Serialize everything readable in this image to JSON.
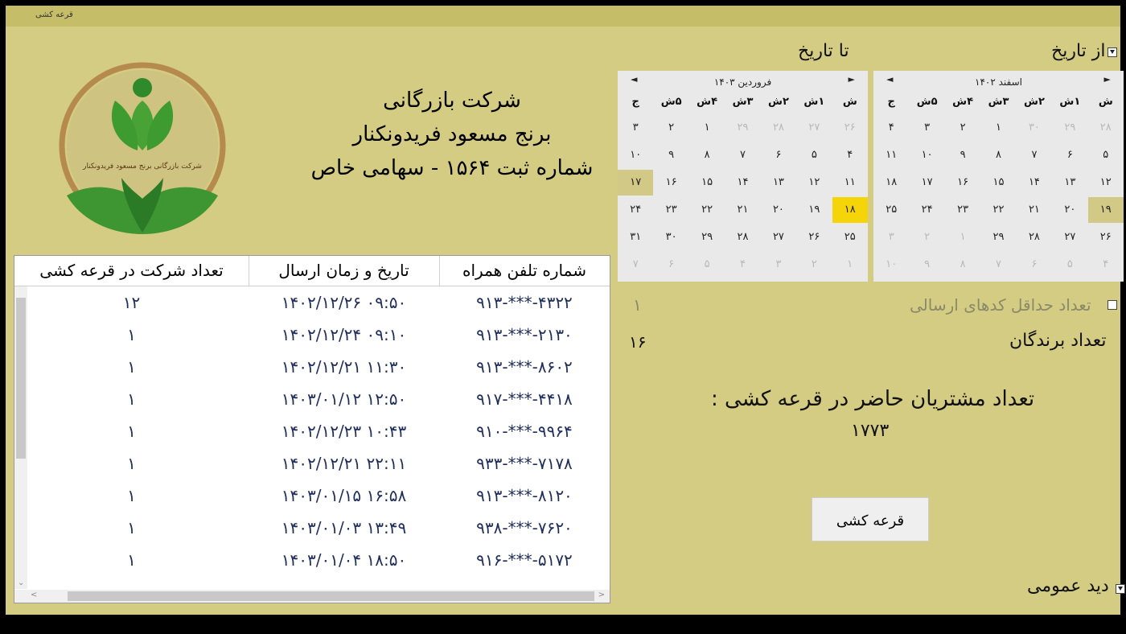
{
  "window": {
    "title": "قرعه کشی"
  },
  "from_date": {
    "label": "از تاریخ",
    "checked": true
  },
  "to_date": {
    "label": "تا تاریخ"
  },
  "calendar_from": {
    "month": "اسفند ۱۴۰۲",
    "prev": "◄",
    "next": "►",
    "weekdays": [
      "ش",
      "۱ش",
      "۲ش",
      "۳ش",
      "۴ش",
      "۵ش",
      "ج"
    ],
    "days": [
      [
        "۲۸",
        "m"
      ],
      [
        "۲۹",
        "m"
      ],
      [
        "۳۰",
        "m"
      ],
      [
        "۱",
        ""
      ],
      [
        "۲",
        ""
      ],
      [
        "۳",
        ""
      ],
      [
        "۴",
        ""
      ],
      [
        "۵",
        ""
      ],
      [
        "۶",
        ""
      ],
      [
        "۷",
        ""
      ],
      [
        "۸",
        ""
      ],
      [
        "۹",
        ""
      ],
      [
        "۱۰",
        ""
      ],
      [
        "۱۱",
        ""
      ],
      [
        "۱۲",
        ""
      ],
      [
        "۱۳",
        ""
      ],
      [
        "۱۴",
        ""
      ],
      [
        "۱۵",
        ""
      ],
      [
        "۱۶",
        ""
      ],
      [
        "۱۷",
        ""
      ],
      [
        "۱۸",
        ""
      ],
      [
        "۱۹",
        "sel"
      ],
      [
        "۲۰",
        ""
      ],
      [
        "۲۱",
        ""
      ],
      [
        "۲۲",
        ""
      ],
      [
        "۲۳",
        ""
      ],
      [
        "۲۴",
        ""
      ],
      [
        "۲۵",
        ""
      ],
      [
        "۲۶",
        ""
      ],
      [
        "۲۷",
        ""
      ],
      [
        "۲۸",
        ""
      ],
      [
        "۲۹",
        ""
      ],
      [
        "۱",
        "m"
      ],
      [
        "۲",
        "m"
      ],
      [
        "۳",
        "m"
      ],
      [
        "۴",
        "m"
      ],
      [
        "۵",
        "m"
      ],
      [
        "۶",
        "m"
      ],
      [
        "۷",
        "m"
      ],
      [
        "۸",
        "m"
      ],
      [
        "۹",
        "m"
      ],
      [
        "۱۰",
        "m"
      ]
    ]
  },
  "calendar_to": {
    "month": "فروردین ۱۴۰۳",
    "prev": "◄",
    "next": "►",
    "weekdays": [
      "ش",
      "۱ش",
      "۲ش",
      "۳ش",
      "۴ش",
      "۵ش",
      "ج"
    ],
    "days": [
      [
        "۲۶",
        "m"
      ],
      [
        "۲۷",
        "m"
      ],
      [
        "۲۸",
        "m"
      ],
      [
        "۲۹",
        "m"
      ],
      [
        "۱",
        ""
      ],
      [
        "۲",
        ""
      ],
      [
        "۳",
        ""
      ],
      [
        "۴",
        ""
      ],
      [
        "۵",
        ""
      ],
      [
        "۶",
        ""
      ],
      [
        "۷",
        ""
      ],
      [
        "۸",
        ""
      ],
      [
        "۹",
        ""
      ],
      [
        "۱۰",
        ""
      ],
      [
        "۱۱",
        ""
      ],
      [
        "۱۲",
        ""
      ],
      [
        "۱۳",
        ""
      ],
      [
        "۱۴",
        ""
      ],
      [
        "۱۵",
        ""
      ],
      [
        "۱۶",
        ""
      ],
      [
        "۱۷",
        "sel"
      ],
      [
        "۱۸",
        "today"
      ],
      [
        "۱۹",
        ""
      ],
      [
        "۲۰",
        ""
      ],
      [
        "۲۱",
        ""
      ],
      [
        "۲۲",
        ""
      ],
      [
        "۲۳",
        ""
      ],
      [
        "۲۴",
        ""
      ],
      [
        "۲۵",
        ""
      ],
      [
        "۲۶",
        ""
      ],
      [
        "۲۷",
        ""
      ],
      [
        "۲۸",
        ""
      ],
      [
        "۲۹",
        ""
      ],
      [
        "۳۰",
        ""
      ],
      [
        "۳۱",
        ""
      ],
      [
        "۱",
        "m"
      ],
      [
        "۲",
        "m"
      ],
      [
        "۳",
        "m"
      ],
      [
        "۴",
        "m"
      ],
      [
        "۵",
        "m"
      ],
      [
        "۶",
        "m"
      ],
      [
        "۷",
        "m"
      ]
    ]
  },
  "company": {
    "line1": "شرکت بازرگانی",
    "line2": "برنج مسعود فریدونکنار",
    "line3": "شماره ثبت ۱۵۶۴ - سهامی خاص",
    "logo_text": "شرکت بازرگانی برنج مسعود فریدونکنار"
  },
  "min_codes": {
    "label": "تعداد حداقل کدهای ارسالی",
    "value": "۱",
    "checked": false
  },
  "winners": {
    "label": "تعداد برندگان",
    "value": "۱۶"
  },
  "attendees": {
    "label": "تعداد مشتریان حاضر در قرعه کشی :",
    "value": "۱۷۷۳"
  },
  "draw_button": "قرعه کشی",
  "overview": {
    "label": "دید عمومی",
    "checked": true
  },
  "table": {
    "columns": [
      "شماره تلفن همراه",
      "تاریخ و زمان ارسال",
      "تعداد شرکت در قرعه کشی"
    ],
    "rows": [
      [
        "۹۱۳-***-۴۳۲۲",
        "۱۴۰۲/۱۲/۲۶ ۰۹:۵۰",
        "۱۲"
      ],
      [
        "۹۱۳-***-۲۱۳۰",
        "۱۴۰۲/۱۲/۲۴ ۰۹:۱۰",
        "۱"
      ],
      [
        "۹۱۳-***-۸۶۰۲",
        "۱۴۰۲/۱۲/۲۱ ۱۱:۳۰",
        "۱"
      ],
      [
        "۹۱۷-***-۴۴۱۸",
        "۱۴۰۳/۰۱/۱۲ ۱۲:۵۰",
        "۱"
      ],
      [
        "۹۱۰-***-۹۹۶۴",
        "۱۴۰۲/۱۲/۲۳ ۱۰:۴۳",
        "۱"
      ],
      [
        "۹۳۳-***-۷۱۷۸",
        "۱۴۰۲/۱۲/۲۱ ۲۲:۱۱",
        "۱"
      ],
      [
        "۹۱۳-***-۸۱۲۰",
        "۱۴۰۳/۰۱/۱۵ ۱۶:۵۸",
        "۱"
      ],
      [
        "۹۳۸-***-۷۶۲۰",
        "۱۴۰۳/۰۱/۰۳ ۱۳:۴۹",
        "۱"
      ],
      [
        "۹۱۶-***-۵۱۷۲",
        "۱۴۰۳/۰۱/۰۴ ۱۸:۵۰",
        "۱"
      ]
    ]
  },
  "colors": {
    "window_bg": "#d3cc82",
    "titlebar": "#c5bd68",
    "today": "#f5d50a",
    "selected": "#d1c985",
    "cell_text": "#1f2d5c"
  }
}
